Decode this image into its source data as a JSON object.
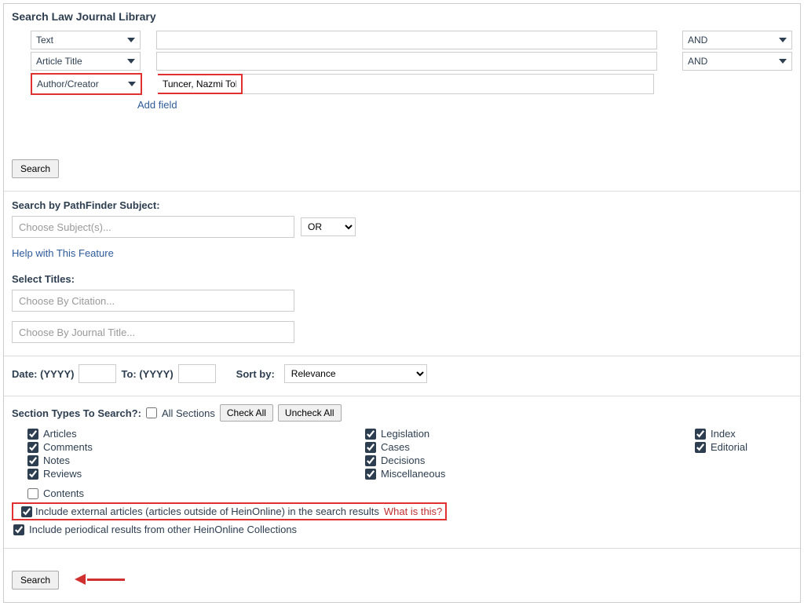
{
  "header": {
    "title": "Search Law Journal Library"
  },
  "search_rows": [
    {
      "field": "Text",
      "value": "",
      "bool": "AND"
    },
    {
      "field": "Article Title",
      "value": "",
      "bool": "AND"
    },
    {
      "field": "Author/Creator",
      "value": "Tuncer, Nazmi Tolga",
      "bool": ""
    }
  ],
  "add_field": "Add field",
  "search_btn": "Search",
  "pathfinder": {
    "label": "Search by PathFinder Subject:",
    "placeholder": "Choose Subject(s)...",
    "bool": "OR",
    "help": "Help with This Feature"
  },
  "titles": {
    "label": "Select Titles:",
    "citation_placeholder": "Choose By Citation...",
    "journal_placeholder": "Choose By Journal Title..."
  },
  "date": {
    "label1": "Date: (YYYY)",
    "label2": "To: (YYYY)",
    "sort_label": "Sort by:",
    "sort_value": "Relevance"
  },
  "section_types": {
    "label": "Section Types To Search?:",
    "all_sections": "All Sections",
    "check_all": "Check All",
    "uncheck_all": "Uncheck All",
    "items_col1": [
      "Articles",
      "Comments",
      "Notes",
      "Reviews"
    ],
    "items_col1_extra": "Contents",
    "items_col2": [
      "Legislation",
      "Cases",
      "Decisions",
      "Miscellaneous"
    ],
    "items_col3": [
      "Index",
      "Editorial"
    ]
  },
  "external": {
    "text": "Include external articles (articles outside of HeinOnline) in the search results",
    "what": "What is this?"
  },
  "periodical": {
    "text": "Include periodical results from other HeinOnline Collections"
  }
}
